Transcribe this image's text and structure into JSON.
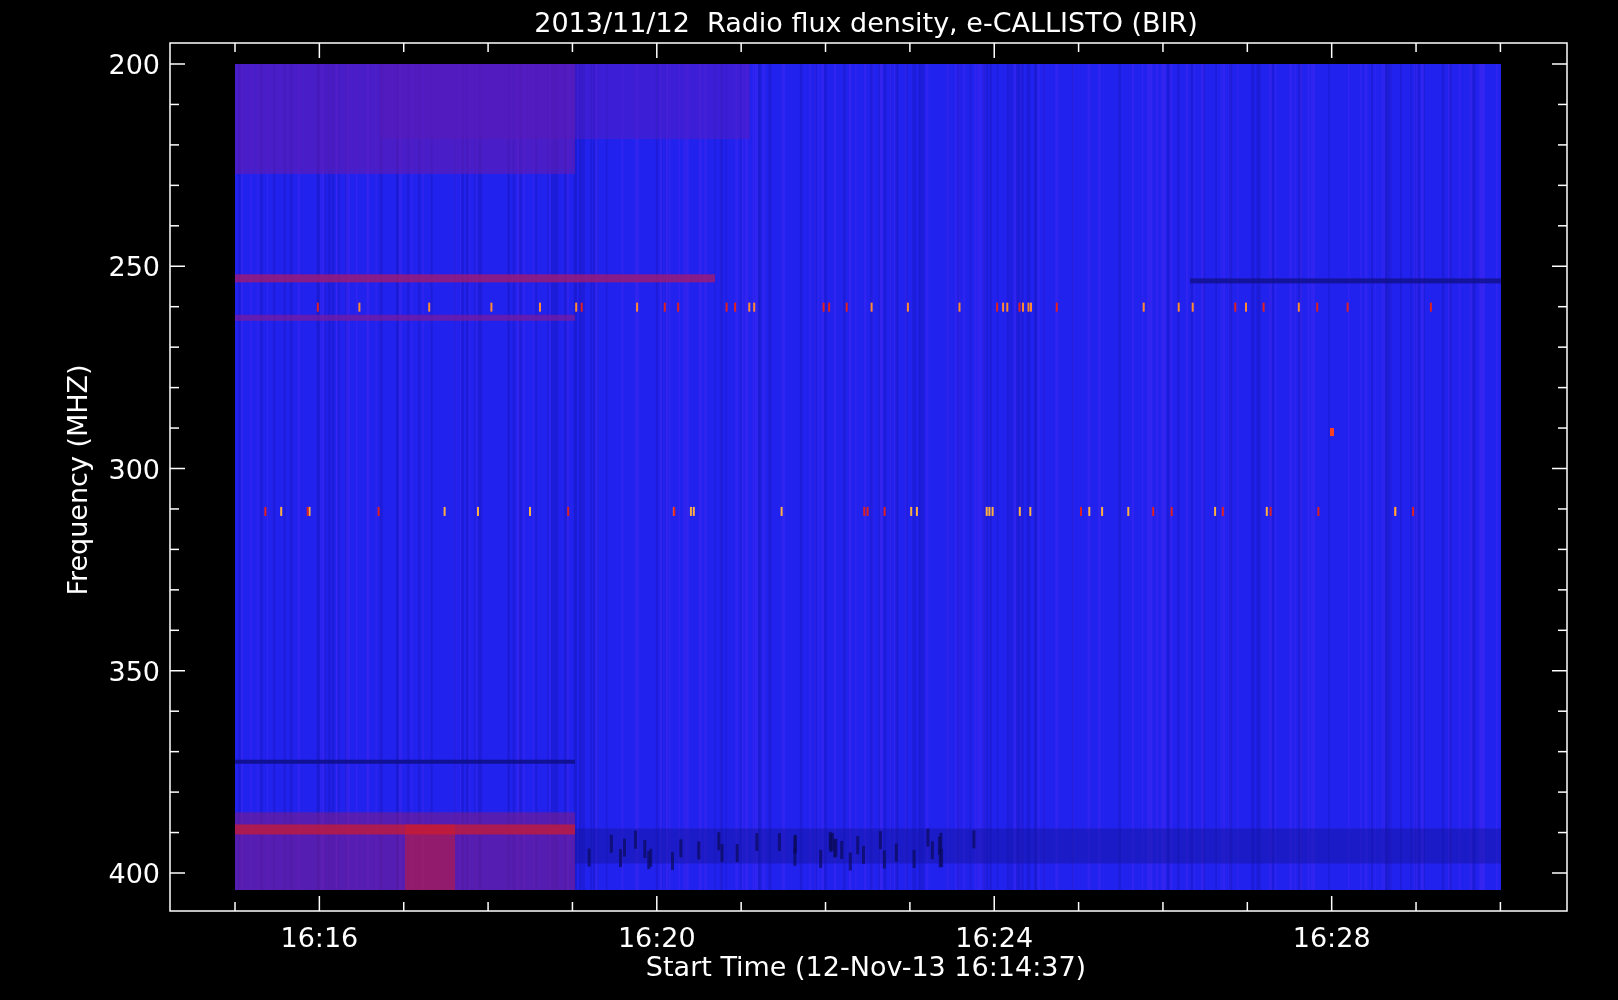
{
  "title": "2013/11/12  Radio flux density, e-CALLISTO (BIR)",
  "y_axis": {
    "label": "Frequency (MHZ)",
    "ticks": [
      "200",
      "250",
      "300",
      "350",
      "400"
    ]
  },
  "x_axis": {
    "label": "Start Time (12-Nov-13 16:14:37)",
    "ticks": [
      "16:16",
      "16:20",
      "16:24",
      "16:28"
    ]
  }
}
